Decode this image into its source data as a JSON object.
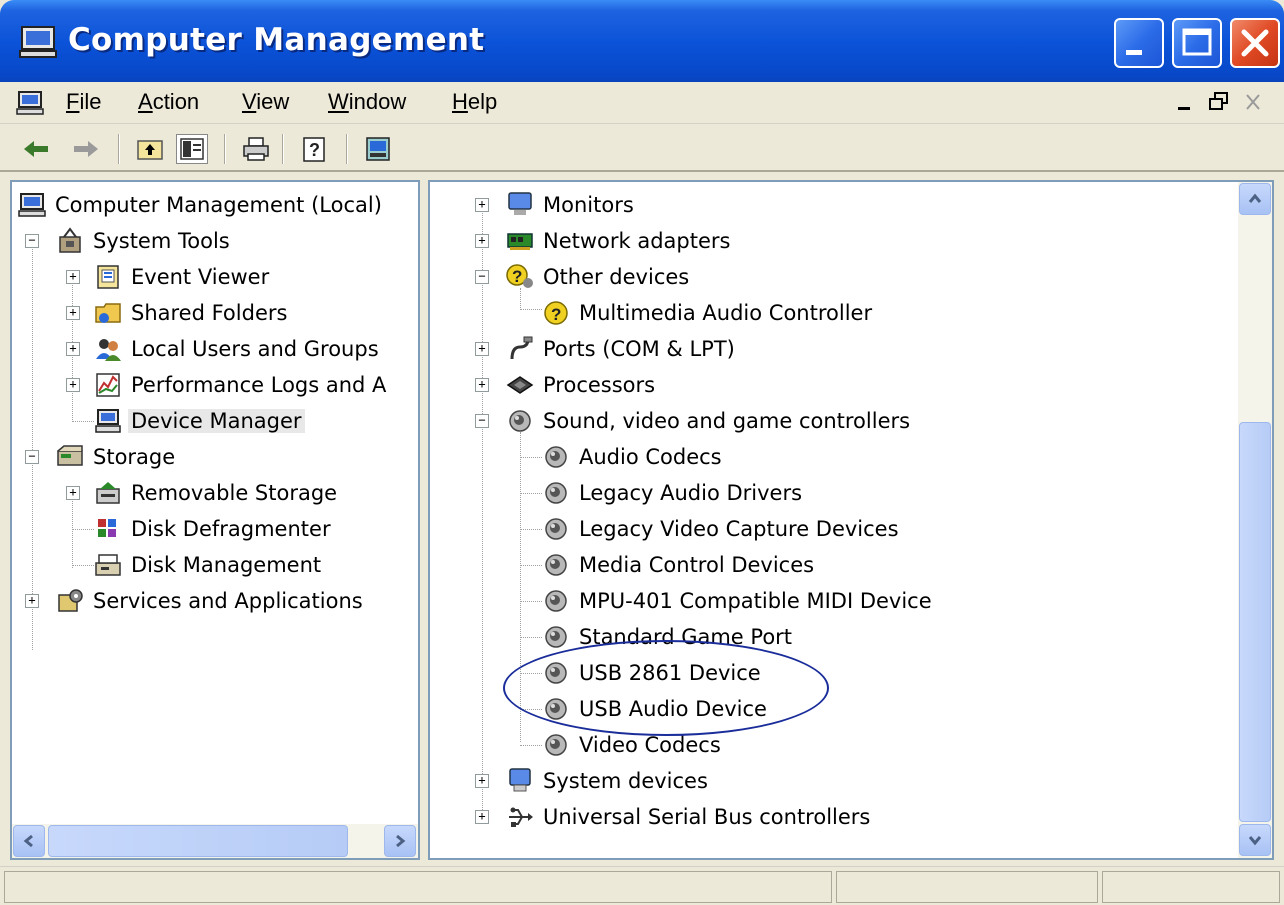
{
  "window": {
    "title": "Computer Management",
    "title_icon": "computer-management-icon",
    "controls": [
      "minimize-icon",
      "maximize-icon",
      "close-icon"
    ]
  },
  "menubar": {
    "items": [
      {
        "label": "File",
        "accel": "F"
      },
      {
        "label": "Action",
        "accel": "A"
      },
      {
        "label": "View",
        "accel": "V"
      },
      {
        "label": "Window",
        "accel": "W"
      },
      {
        "label": "Help",
        "accel": "H"
      }
    ],
    "mdi_controls": [
      "_",
      "restore",
      "x"
    ]
  },
  "toolbar": {
    "buttons": [
      "back-icon",
      "forward-icon",
      "up-one-level-icon",
      "show-hide-tree-icon",
      "print-icon",
      "help-icon",
      "properties-icon"
    ]
  },
  "left_tree": {
    "items": [
      {
        "label": "Computer Management (Local)",
        "icon": "computer-icon"
      },
      {
        "label": "System Tools",
        "icon": "tools-icon",
        "expander": "−"
      },
      {
        "label": "Event Viewer",
        "icon": "event-viewer-icon",
        "expander": "+"
      },
      {
        "label": "Shared Folders",
        "icon": "shared-folder-icon",
        "expander": "+"
      },
      {
        "label": "Local Users and Groups",
        "icon": "users-icon",
        "expander": "+"
      },
      {
        "label": "Performance Logs and A",
        "icon": "performance-icon",
        "expander": "+"
      },
      {
        "label": "Device Manager",
        "icon": "device-manager-icon",
        "selected": true
      },
      {
        "label": "Storage",
        "icon": "storage-icon",
        "expander": "−"
      },
      {
        "label": "Removable Storage",
        "icon": "removable-storage-icon",
        "expander": "+"
      },
      {
        "label": "Disk Defragmenter",
        "icon": "defragmenter-icon"
      },
      {
        "label": "Disk Management",
        "icon": "disk-management-icon"
      },
      {
        "label": "Services and Applications",
        "icon": "services-icon",
        "expander": "+"
      }
    ]
  },
  "device_tree": {
    "items": [
      {
        "label": "Monitors",
        "icon": "monitor-icon",
        "expander": "+"
      },
      {
        "label": "Network adapters",
        "icon": "network-adapter-icon",
        "expander": "+"
      },
      {
        "label": "Other devices",
        "icon": "unknown-device-icon",
        "expander": "−"
      },
      {
        "label": "Multimedia Audio Controller",
        "icon": "warning-device-icon"
      },
      {
        "label": "Ports (COM & LPT)",
        "icon": "port-icon",
        "expander": "+"
      },
      {
        "label": "Processors",
        "icon": "processor-icon",
        "expander": "+"
      },
      {
        "label": "Sound, video and game controllers",
        "icon": "speaker-icon",
        "expander": "−"
      },
      {
        "label": "Audio Codecs",
        "icon": "speaker-icon"
      },
      {
        "label": "Legacy Audio Drivers",
        "icon": "speaker-icon"
      },
      {
        "label": "Legacy Video Capture Devices",
        "icon": "speaker-icon"
      },
      {
        "label": "Media Control Devices",
        "icon": "speaker-icon"
      },
      {
        "label": "MPU-401 Compatible MIDI Device",
        "icon": "speaker-icon"
      },
      {
        "label": "Standard Game Port",
        "icon": "speaker-icon"
      },
      {
        "label": "USB 2861 Device",
        "icon": "speaker-icon"
      },
      {
        "label": "USB Audio Device",
        "icon": "speaker-icon"
      },
      {
        "label": "Video Codecs",
        "icon": "speaker-icon"
      },
      {
        "label": "System devices",
        "icon": "system-device-icon",
        "expander": "+"
      },
      {
        "label": "Universal Serial Bus controllers",
        "icon": "usb-icon",
        "expander": "+"
      }
    ]
  },
  "colors": {
    "titlebar": "#0a52d8",
    "annotation": "#1a2d9a",
    "close_button": "#e04a25"
  }
}
